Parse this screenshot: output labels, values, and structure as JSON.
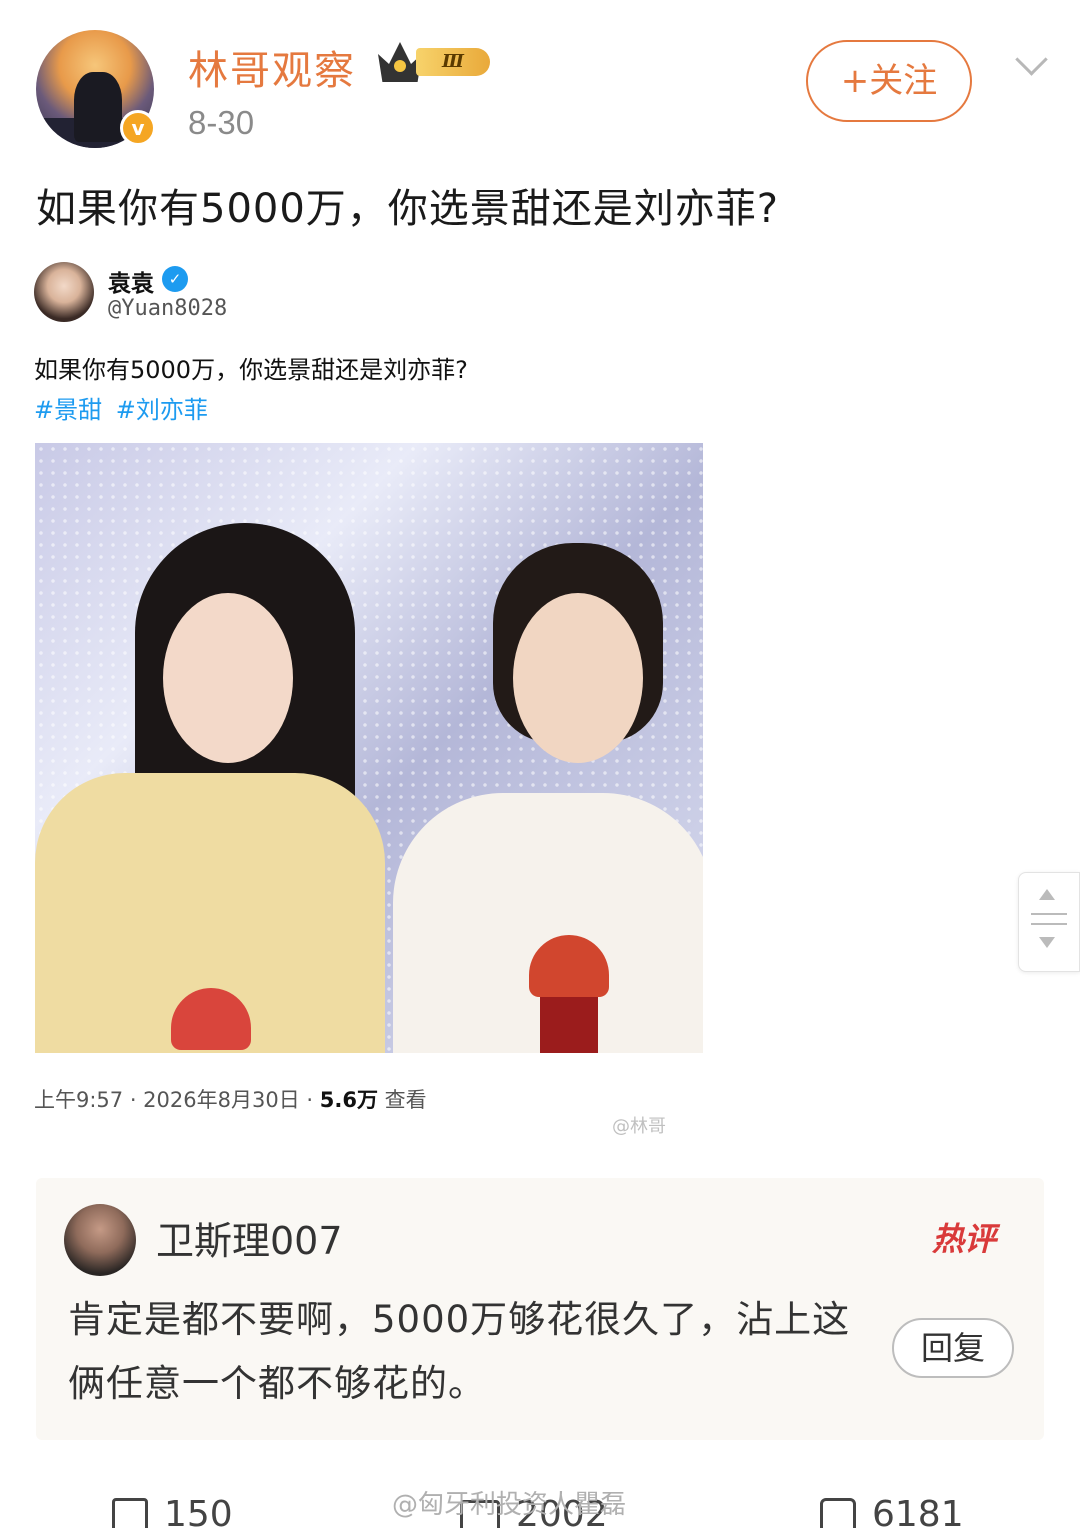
{
  "post": {
    "author": "林哥观察",
    "level_badge": "Ⅲ",
    "date": "8-30",
    "follow_label": "+关注",
    "text": "如果你有5000万，你选景甜还是刘亦菲?"
  },
  "quoted_tweet": {
    "name": "袁袁",
    "handle": "@Yuan8028",
    "text": "如果你有5000万，你选景甜还是刘亦菲?",
    "tags": [
      "#景甜",
      "#刘亦菲"
    ],
    "meta_time": "上午9:57 · 2026年8月30日 · ",
    "views": "5.6万",
    "views_label": " 查看",
    "watermark": "@林哥"
  },
  "hot_comment": {
    "user": "卫斯理007",
    "tag": "热评",
    "text": "肯定是都不要啊，5000万够花很久了，沾上这俩任意一个都不够花的。",
    "reply_label": "回复"
  },
  "actions": {
    "share_count": "150",
    "comment_count": "2002",
    "like_count": "6181"
  },
  "watermark_bottom": "@匈牙利投资人瞿磊",
  "icons": {
    "verified": "v-badge-icon",
    "crown": "crown-icon",
    "chevron": "chevron-down-icon",
    "share": "share-icon",
    "comment": "comment-icon",
    "like": "like-icon"
  },
  "colors": {
    "accent": "#e5793f",
    "link": "#1d9bf0",
    "hot": "#d93a3a"
  }
}
